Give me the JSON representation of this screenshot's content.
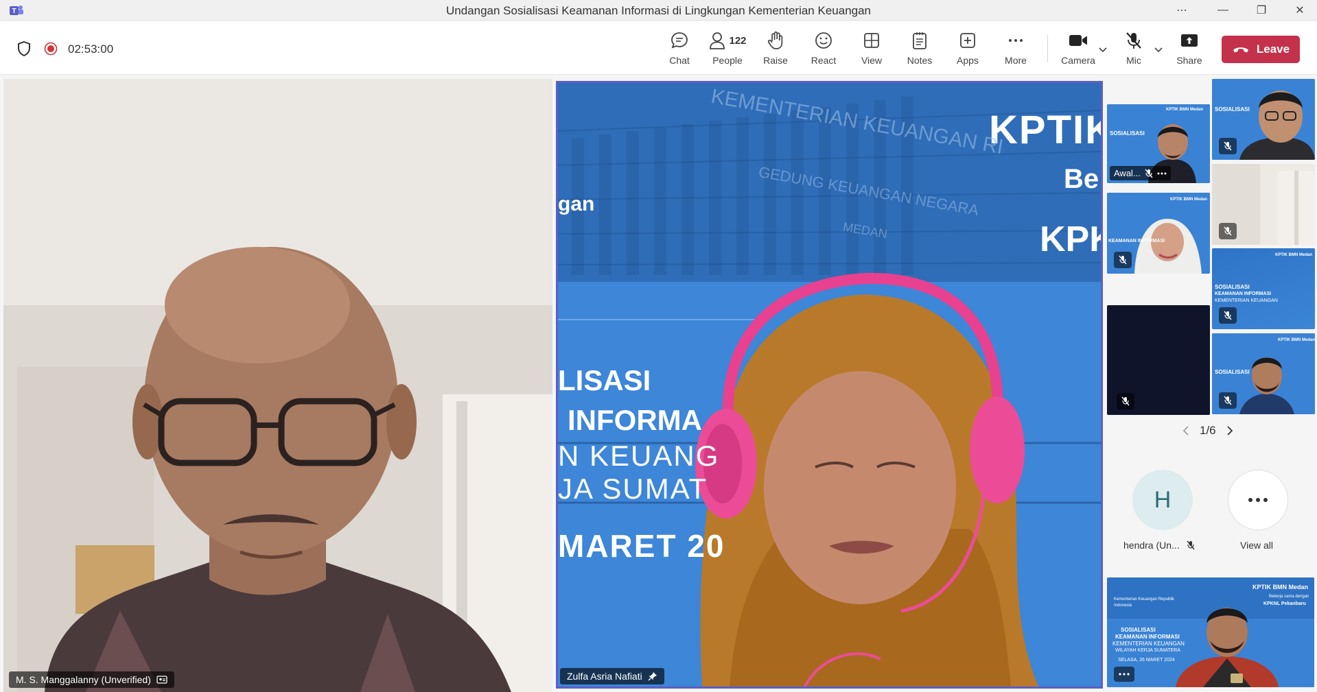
{
  "window": {
    "title": "Undangan Sosialisasi Keamanan Informasi di Lingkungan Kementerian Keuangan",
    "more_label": "⋯",
    "minimize_label": "—",
    "maximize_label": "❐",
    "close_label": "✕"
  },
  "meeting": {
    "timer": "02:53:00"
  },
  "toolbar": {
    "chat": "Chat",
    "people": "People",
    "people_count": "122",
    "raise": "Raise",
    "react": "React",
    "view": "View",
    "notes": "Notes",
    "apps": "Apps",
    "more": "More",
    "camera": "Camera",
    "mic": "Mic",
    "share": "Share",
    "leave": "Leave"
  },
  "participants": {
    "left_name": "M. S. Manggalanny (Unverified)",
    "main_name": "Zulfa Asria Nafiati",
    "thumb_awal": "Awal..."
  },
  "slide": {
    "big_top": "KPTIK",
    "big_be": "Be",
    "big_kpk": "KPK",
    "gan": "gan",
    "line1": "LISASI",
    "line2": "INFORMA",
    "line3": "N KEUANG",
    "line4": "JA SUMAT",
    "line5": "MARET 20",
    "building1": "KEMENTERIAN KEUANGAN RI",
    "building2": "GEDUNG KEUANGAN NEGARA",
    "building3": "MEDAN"
  },
  "mini_slide": {
    "kptik": "KPTIK BMN Medan",
    "bekerja": "Bekerja sama dengan",
    "kpknl": "KPKNL Pekanbaru",
    "kemenkeu": "Kementerian Keuangan Republik Indonesia",
    "sos1": "SOSIALISASI",
    "sos2": "KEAMANAN INFORMASI",
    "sos3": "KEMENTERIAN KEUANGAN",
    "sos4": "WILAYAH KERJA SUMATERA",
    "sos5": "SELASA, 26 MARET 2024"
  },
  "gallery": {
    "page": "1/6",
    "hendra_initial": "H",
    "hendra_name": "hendra (Un...",
    "view_all": "View all"
  },
  "colors": {
    "accent": "#5b5fc7",
    "leave": "#c4314b",
    "record": "#d13438"
  }
}
